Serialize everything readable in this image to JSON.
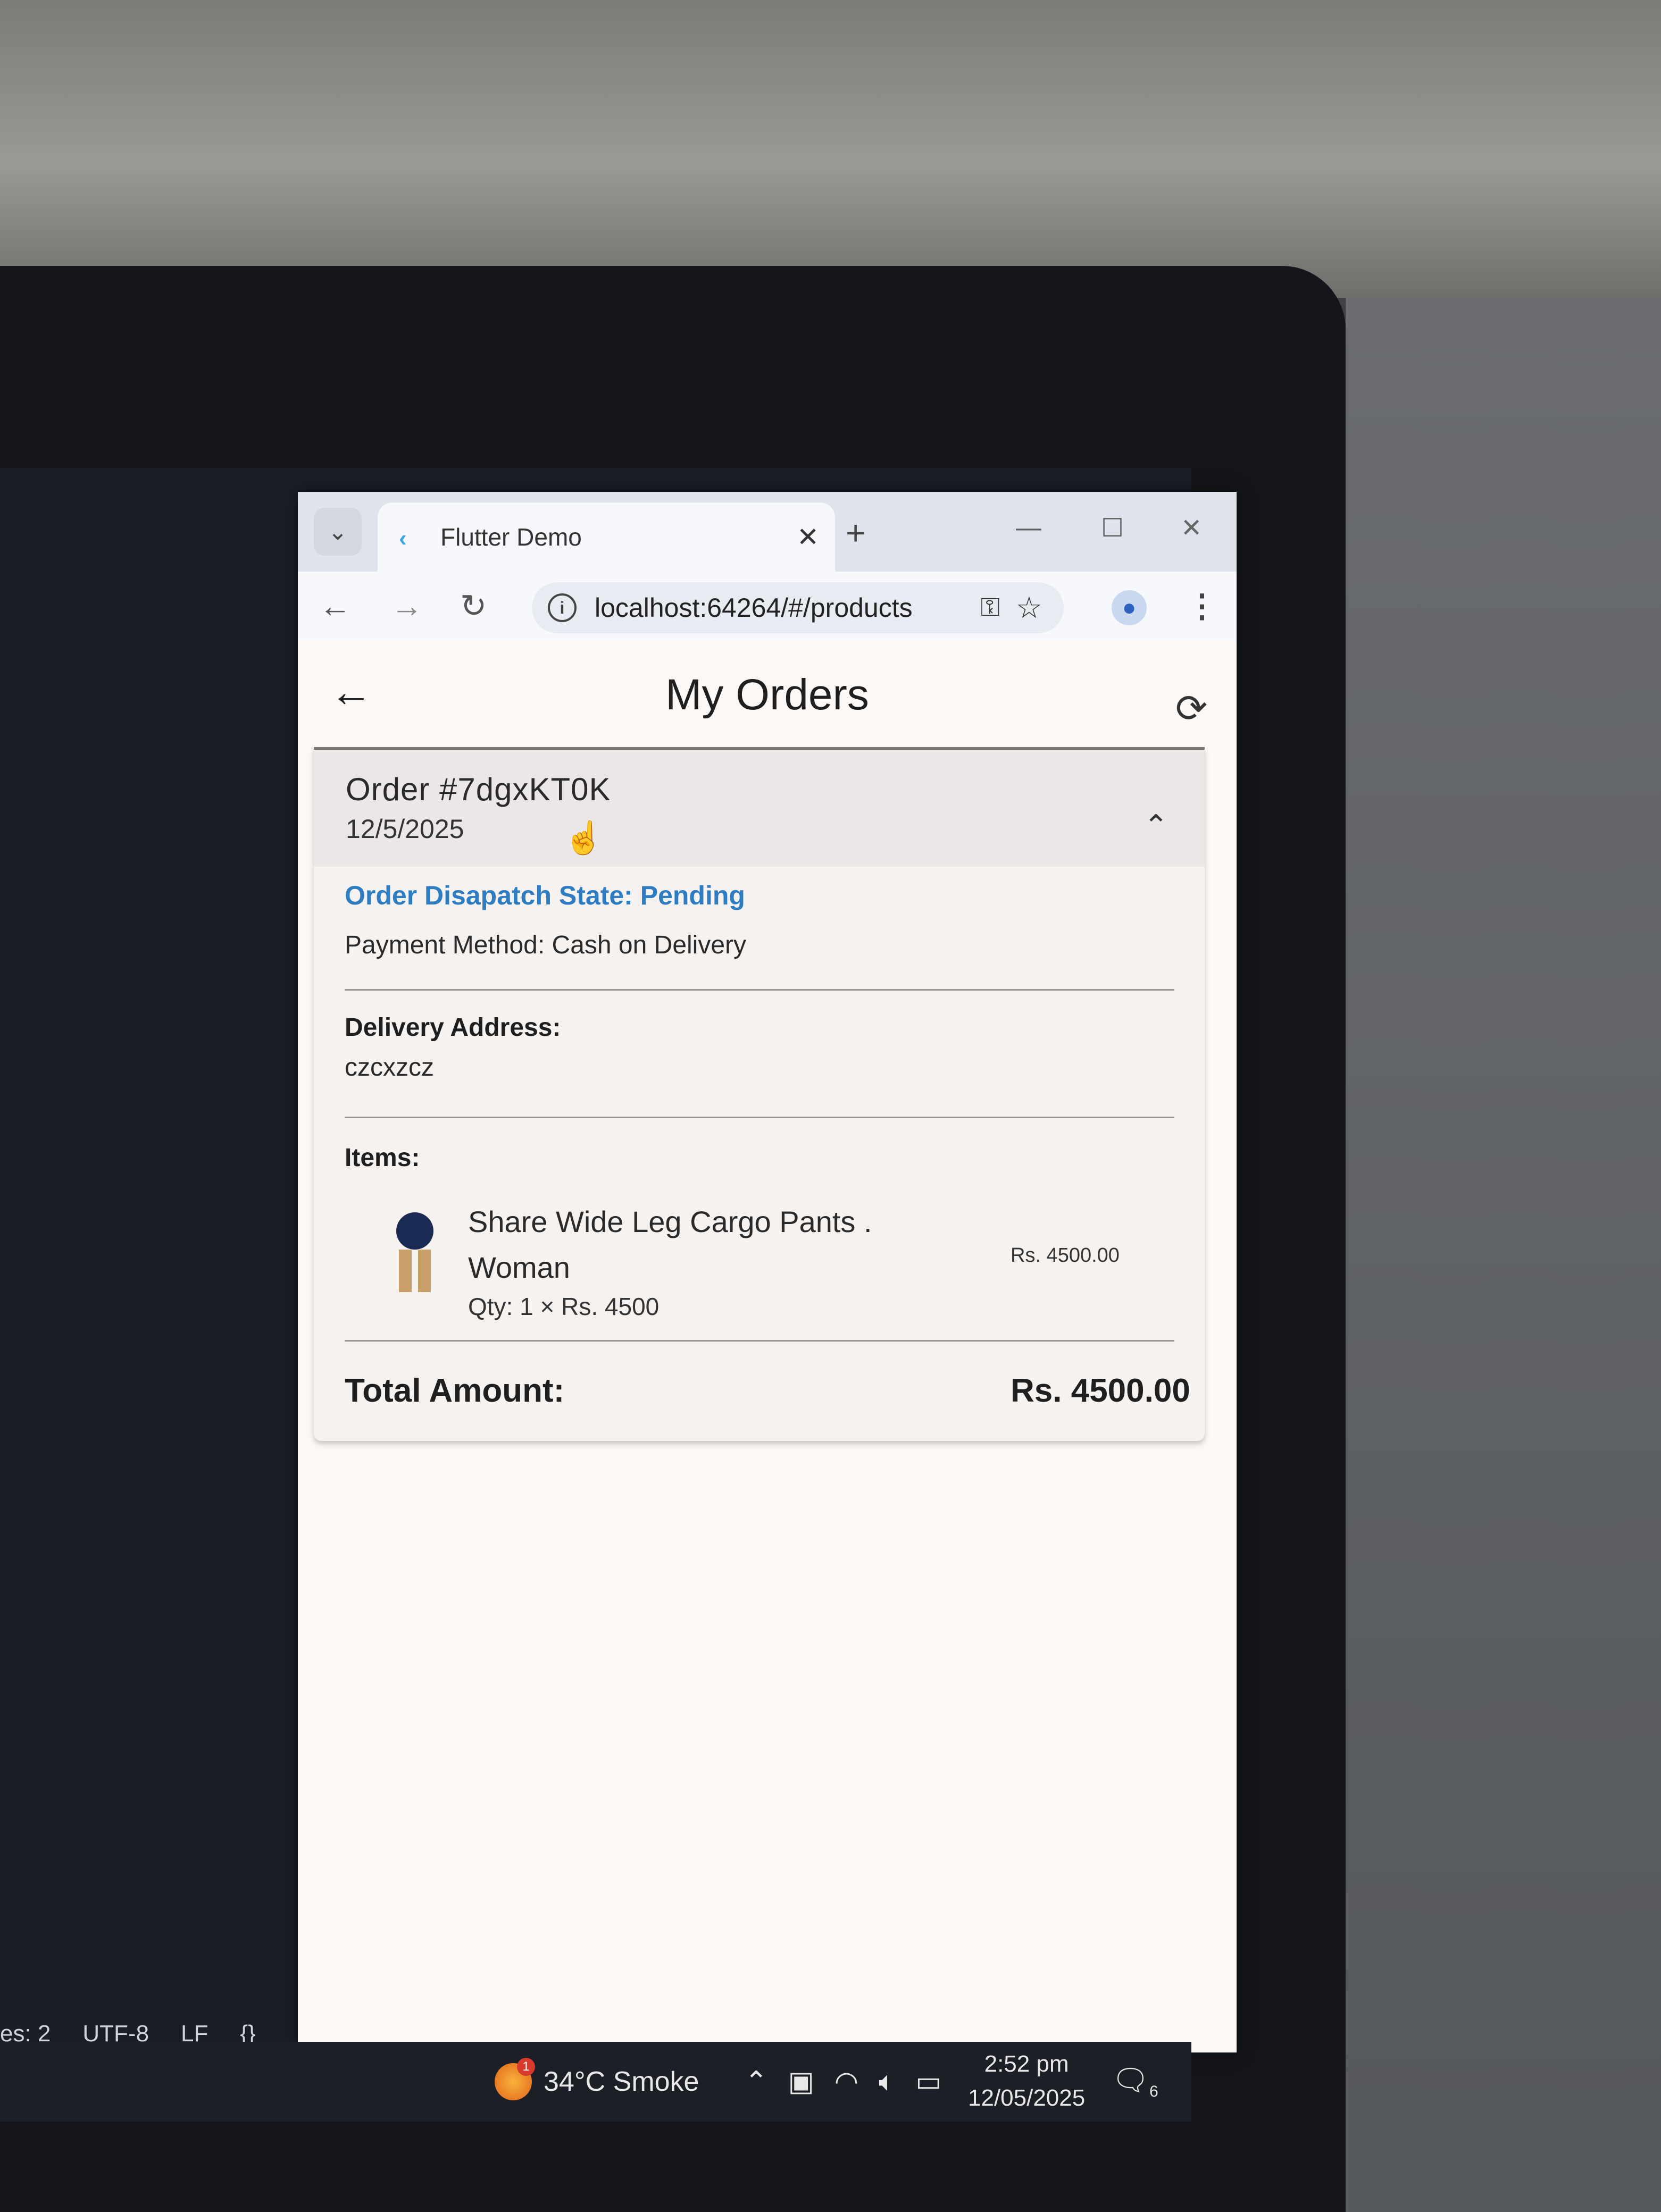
{
  "browser": {
    "tab_title": "Flutter Demo",
    "url": "localhost:64264/#/products"
  },
  "page": {
    "title": "My Orders"
  },
  "order": {
    "id_text": "Order #7dgxKT0K",
    "date": "12/5/2025",
    "dispatch_state": "Order Disapatch State: Pending",
    "payment_method": "Payment Method: Cash on Delivery",
    "delivery_label": "Delivery Address:",
    "delivery_address": "czcxzcz",
    "items_label": "Items:",
    "items": [
      {
        "name": "Share Wide Leg Cargo Pants . Woman",
        "qty_line": "Qty: 1 × Rs. 4500",
        "line_total": "Rs. 4500.00"
      }
    ],
    "total_label": "Total Amount:",
    "total_value": "Rs. 4500.00"
  },
  "editor_status": {
    "spaces": "es: 2",
    "encoding": "UTF-8",
    "eol": "LF",
    "braces": "{}"
  },
  "taskbar": {
    "weather": "34°C  Smoke",
    "weather_badge": "1",
    "time": "2:52 pm",
    "date": "12/05/2025",
    "notifications": "6"
  }
}
